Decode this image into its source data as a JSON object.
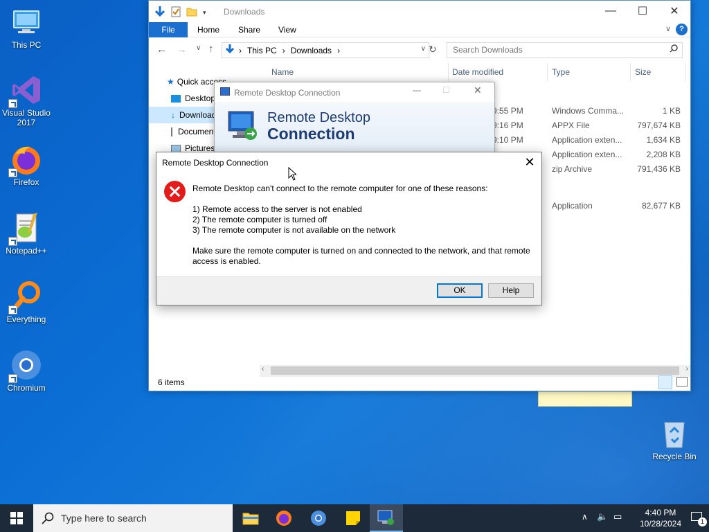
{
  "desktop": {
    "icons": [
      {
        "label": "This PC"
      },
      {
        "label": "Visual Studio\n2017"
      },
      {
        "label": "Firefox"
      },
      {
        "label": "Notepad++"
      },
      {
        "label": "Everything"
      },
      {
        "label": "Chromium"
      },
      {
        "label": "Recycle Bin"
      }
    ]
  },
  "explorer": {
    "title": "Downloads",
    "ribbon_tabs": [
      "File",
      "Home",
      "Share",
      "View"
    ],
    "breadcrumb": [
      "This PC",
      "Downloads"
    ],
    "search_placeholder": "Search Downloads",
    "columns": [
      "Name",
      "Date modified",
      "Type",
      "Size"
    ],
    "nav_items": [
      "Quick access",
      "Desktop",
      "Downloads",
      "Documents",
      "Pictures"
    ],
    "files": [
      {
        "date": "9:55 PM",
        "type": "Windows Comma...",
        "size": "1 KB"
      },
      {
        "date": "9:16 PM",
        "type": "APPX File",
        "size": "797,674 KB"
      },
      {
        "date": "9:10 PM",
        "type": "Application exten...",
        "size": "1,634 KB"
      },
      {
        "date": "",
        "type": "Application exten...",
        "size": "2,208 KB"
      },
      {
        "date": "",
        "type": "zip Archive",
        "size": "791,436 KB"
      },
      {
        "date": "",
        "type": "Application",
        "size": "82,677 KB"
      }
    ],
    "status": "6 items"
  },
  "rdc_window": {
    "title": "Remote Desktop Connection",
    "banner_line1": "Remote Desktop",
    "banner_line2": "Connection"
  },
  "dialog": {
    "title": "Remote Desktop Connection",
    "headline": "Remote Desktop can't connect to the remote computer for one of these reasons:",
    "reasons": [
      "1) Remote access to the server is not enabled",
      "2) The remote computer is turned off",
      "3) The remote computer is not available on the network"
    ],
    "advice_line1": "Make sure the remote computer is turned on and connected to the network, and that remote",
    "advice_line2": "access is enabled.",
    "ok_label": "OK",
    "help_label": "Help"
  },
  "taskbar": {
    "search_placeholder": "Type here to search",
    "time": "4:40 PM",
    "date": "10/28/2024",
    "notification_count": "1"
  }
}
